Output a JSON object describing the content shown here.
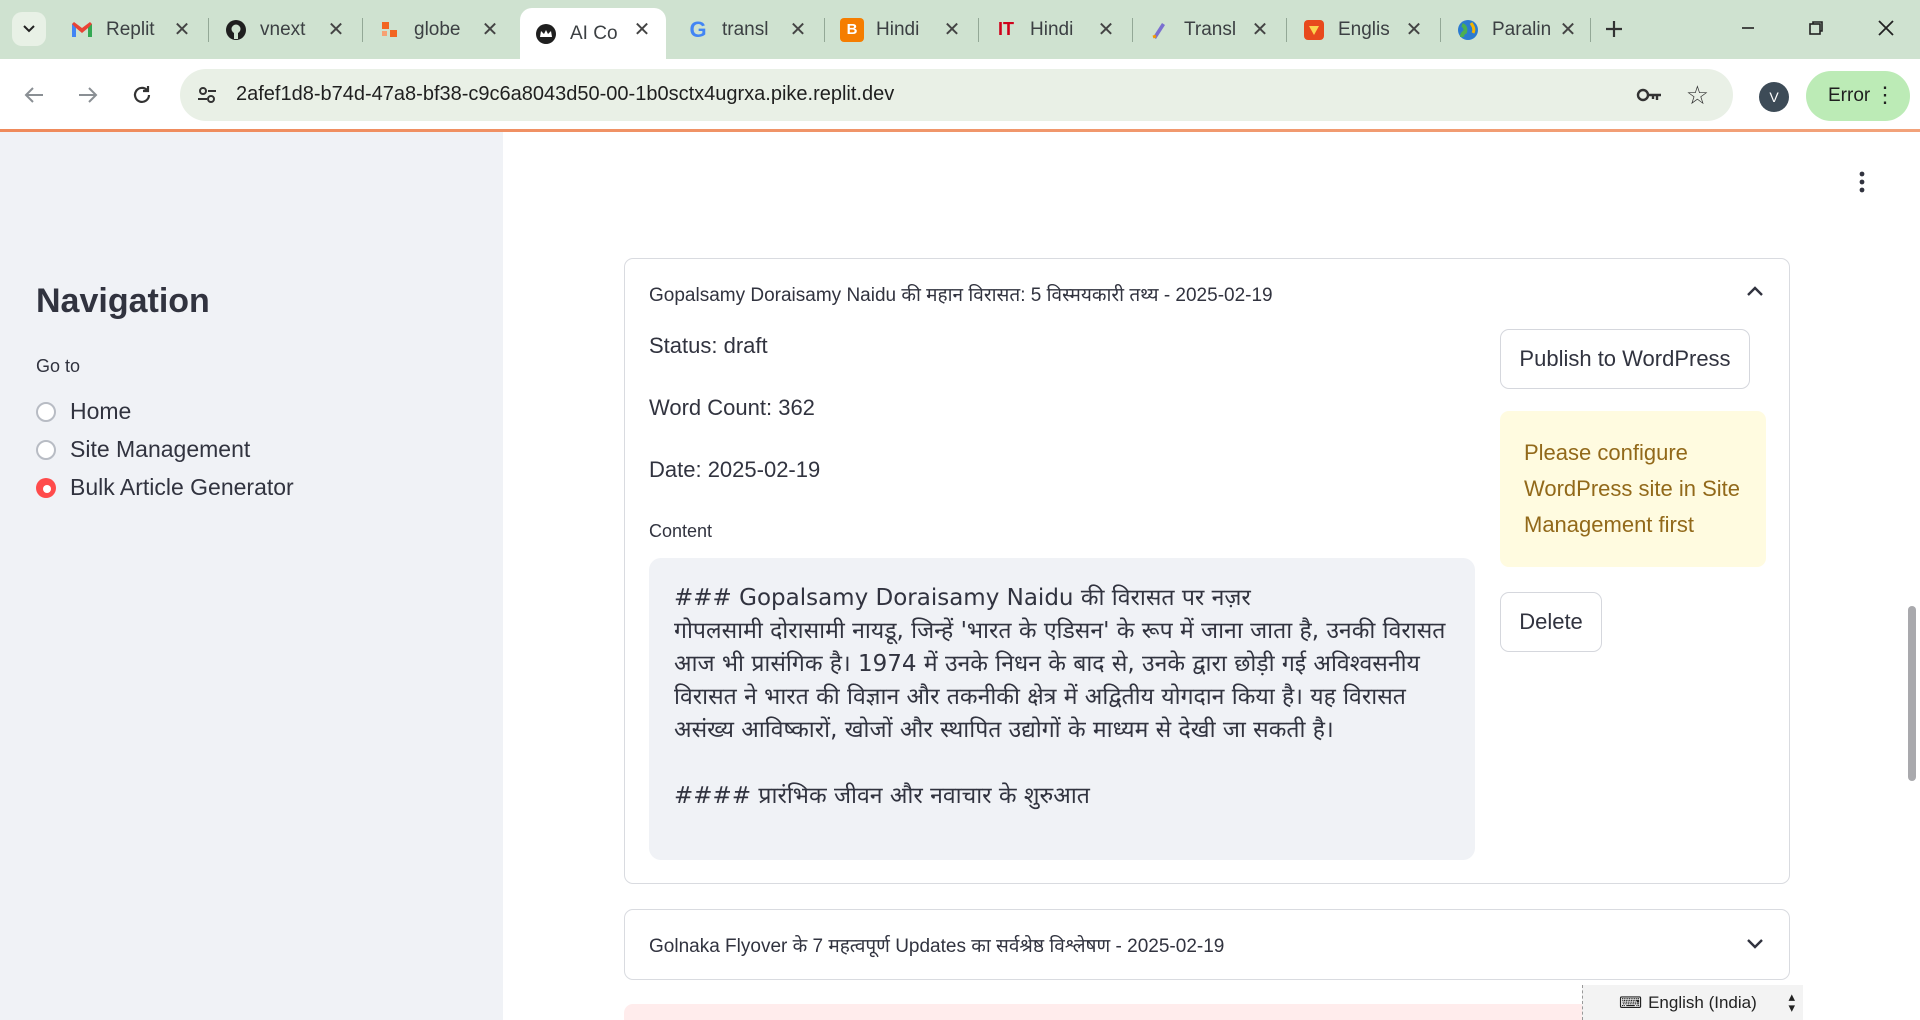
{
  "browser": {
    "tabs": [
      {
        "title": "Replit",
        "icon": "gmail-icon",
        "active": false
      },
      {
        "title": "vnext",
        "icon": "github-icon",
        "active": false
      },
      {
        "title": "globe",
        "icon": "globe-app-icon",
        "active": false
      },
      {
        "title": "AI Co",
        "icon": "crown-icon",
        "active": true
      },
      {
        "title": "transl",
        "icon": "google-icon",
        "active": false
      },
      {
        "title": "Hindi",
        "icon": "blogger-icon",
        "active": false
      },
      {
        "title": "Hindi",
        "icon": "it-icon",
        "active": false
      },
      {
        "title": "Transl",
        "icon": "translate-pen-icon",
        "active": false
      },
      {
        "title": "Englis",
        "icon": "dictionary-icon",
        "active": false
      },
      {
        "title": "Paralin",
        "icon": "globe-colorful-icon",
        "active": false
      }
    ],
    "url": "2afef1d8-b74d-47a8-bf38-c9c6a8043d50-00-1b0sctx4ugrxa.pike.replit.dev",
    "profile_initial": "V",
    "error_label": "Error"
  },
  "sidebar": {
    "title": "Navigation",
    "go_to_label": "Go to",
    "options": [
      {
        "label": "Home",
        "selected": false
      },
      {
        "label": "Site Management",
        "selected": false
      },
      {
        "label": "Bulk Article Generator",
        "selected": true
      }
    ]
  },
  "articles": [
    {
      "header": "Gopalsamy Doraisamy Naidu की महान विरासत: 5 विस्मयकारी तथ्य - 2025-02-19",
      "expanded": true,
      "status": "Status: draft",
      "word_count": "Word Count: 362",
      "date": "Date: 2025-02-19",
      "content_label": "Content",
      "content": "### Gopalsamy Doraisamy Naidu की विरासत पर नज़र\nगोपलसामी दोरासामी नायडू, जिन्हें 'भारत के एडिसन' के रूप में जाना जाता है, उनकी विरासत आज भी प्रासंगिक है। 1974 में उनके निधन के बाद से, उनके द्वारा छोड़ी गई अविश्वसनीय विरासत ने भारत की विज्ञान और तकनीकी क्षेत्र में अद्वितीय योगदान किया है। यह विरासत असंख्य आविष्कारों, खोजों और स्थापित उद्योगों के माध्यम से देखी जा सकती है।\n\n#### प्रारंभिक जीवन और नवाचार के शुरुआत",
      "publish_button": "Publish to WordPress",
      "warning": "Please configure WordPress site in Site Management first",
      "delete_button": "Delete"
    },
    {
      "header": "Golnaka Flyover के 7 महत्वपूर्ण Updates का सर्वश्रेष्ठ विश्लेषण - 2025-02-19",
      "expanded": false
    }
  ],
  "taskbar": {
    "language": "English (India)"
  },
  "colors": {
    "accent_radio": "#ff4b4b",
    "warning_bg": "#fffbe0",
    "warning_text": "#92691a",
    "sidebar_bg": "#f0f2f6"
  }
}
